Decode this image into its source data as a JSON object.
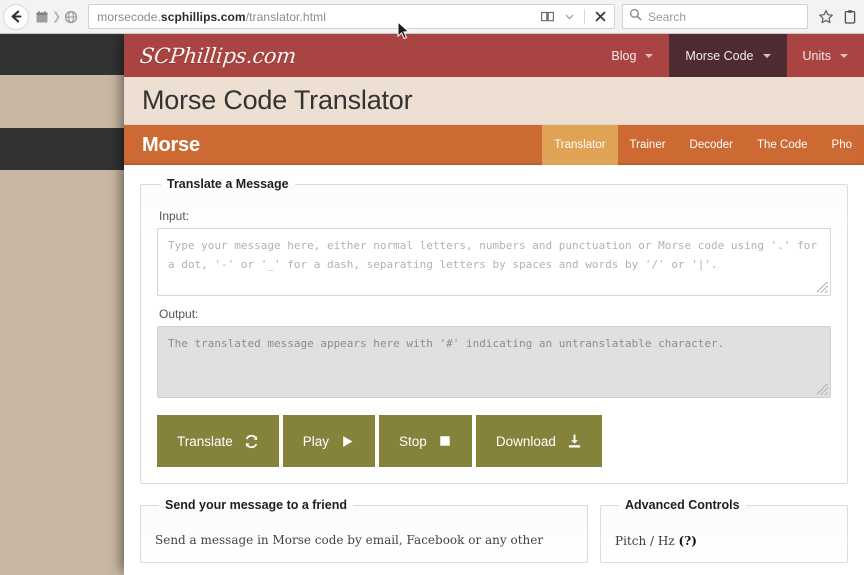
{
  "browser": {
    "back_icon": "back-arrow-icon",
    "breadcrumb_icons": [
      "calendar-icon",
      "globe-icon"
    ],
    "url_prefix": "morsecode.",
    "url_domain": "scphillips.com",
    "url_path": "/translator.html",
    "reader_mode_icon": "reader-view-icon",
    "reader_dropdown_icon": "chevron-down-icon",
    "stop_icon": "stop-x-icon",
    "search_placeholder": "Search",
    "search_icon": "search-icon",
    "bookmark_icon": "star-icon",
    "sidebar_icon": "clipboard-icon"
  },
  "site": {
    "logo": "SCPhillips.com",
    "nav_items": [
      {
        "label": "Blog",
        "active": false,
        "caret": "chevron-down-icon"
      },
      {
        "label": "Morse Code",
        "active": true,
        "caret": "chevron-down-icon"
      },
      {
        "label": "Units",
        "active": false,
        "caret": "chevron-down-icon"
      }
    ],
    "page_title": "Morse Code Translator",
    "section_title": "Morse",
    "section_tabs": [
      {
        "label": "Translator",
        "active": true
      },
      {
        "label": "Trainer",
        "active": false
      },
      {
        "label": "Decoder",
        "active": false
      },
      {
        "label": "The Code",
        "active": false
      },
      {
        "label": "Pho",
        "active": false
      }
    ]
  },
  "translate_panel": {
    "legend": "Translate a Message",
    "input_label": "Input:",
    "input_value": "",
    "input_placeholder": "Type your message here, either normal letters, numbers and punctuation or Morse code using '.' for a dot, '-' or '_' for a dash, separating letters by spaces and words by '/' or '|'.",
    "output_label": "Output:",
    "output_value": "",
    "output_placeholder": "The translated message appears here with '#' indicating an untranslatable character.",
    "buttons": [
      {
        "label": "Translate",
        "icon": "refresh-icon"
      },
      {
        "label": "Play",
        "icon": "play-icon"
      },
      {
        "label": "Stop",
        "icon": "stop-square-icon"
      },
      {
        "label": "Download",
        "icon": "download-icon"
      }
    ]
  },
  "send_panel": {
    "legend": "Send your message to a friend",
    "body": "Send a message in Morse code by email, Facebook or any other"
  },
  "advanced_panel": {
    "legend": "Advanced Controls",
    "pitch_label": "Pitch / Hz",
    "pitch_help": "(?)"
  },
  "colors": {
    "nav_maroon": "#a94442",
    "nav_active": "#4e2b33",
    "title_cream": "#ede0d2",
    "section_orange": "#cd6a33",
    "tab_active_orange": "#e0a254",
    "button_olive": "#84823b",
    "desktop_tan": "#c7b6a1",
    "desktop_dark": "#323232"
  }
}
